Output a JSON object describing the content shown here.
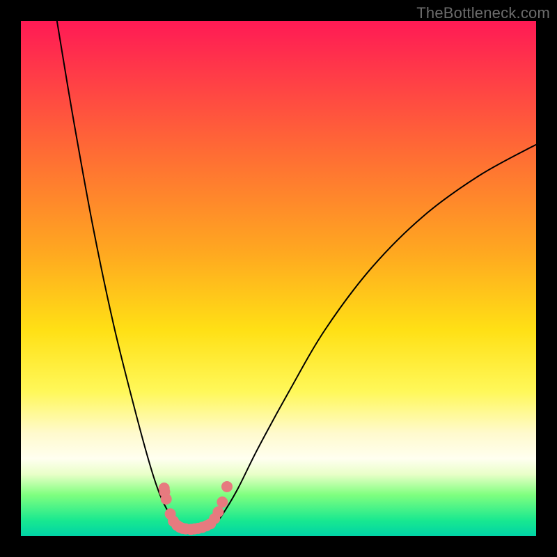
{
  "watermark": "TheBottleneck.com",
  "chart_data": {
    "type": "line",
    "title": "",
    "xlabel": "",
    "ylabel": "",
    "xlim": [
      0,
      100
    ],
    "ylim": [
      0,
      100
    ],
    "grid": false,
    "legend": false,
    "series": [
      {
        "name": "left-curve",
        "color": "#000000",
        "x": [
          7,
          10,
          14,
          18,
          22,
          25,
          27,
          29,
          30.5,
          31
        ],
        "y": [
          100,
          82,
          60,
          41,
          25,
          14,
          8,
          4,
          2,
          1.5
        ]
      },
      {
        "name": "right-curve",
        "color": "#000000",
        "x": [
          37,
          39,
          42,
          46,
          52,
          59,
          68,
          78,
          89,
          100
        ],
        "y": [
          1.5,
          4,
          9,
          17,
          28,
          40,
          52,
          62,
          70,
          76
        ]
      },
      {
        "name": "left-marker-cluster",
        "type": "scatter",
        "color": "#e77a7f",
        "x": [
          27.8,
          27.9,
          28.2,
          29.0,
          29.6,
          30.3,
          30.9,
          31.4,
          32.0
        ],
        "y": [
          9.3,
          8.6,
          7.2,
          4.3,
          2.9,
          2.1,
          1.7,
          1.5,
          1.4
        ]
      },
      {
        "name": "right-marker-cluster",
        "type": "scatter",
        "color": "#e77a7f",
        "x": [
          33.0,
          33.7,
          34.4,
          35.2,
          36.0,
          36.8,
          37.6,
          38.3,
          39.1,
          40.0
        ],
        "y": [
          1.3,
          1.4,
          1.5,
          1.7,
          2.0,
          2.4,
          3.4,
          4.7,
          6.6,
          9.6
        ]
      }
    ],
    "background_gradient": {
      "direction": "vertical",
      "stops": [
        {
          "pos": 0.0,
          "color": "#ff1a55"
        },
        {
          "pos": 0.25,
          "color": "#ff6a35"
        },
        {
          "pos": 0.6,
          "color": "#ffe015"
        },
        {
          "pos": 0.85,
          "color": "#fffff0"
        },
        {
          "pos": 1.0,
          "color": "#00d4a6"
        }
      ]
    }
  }
}
